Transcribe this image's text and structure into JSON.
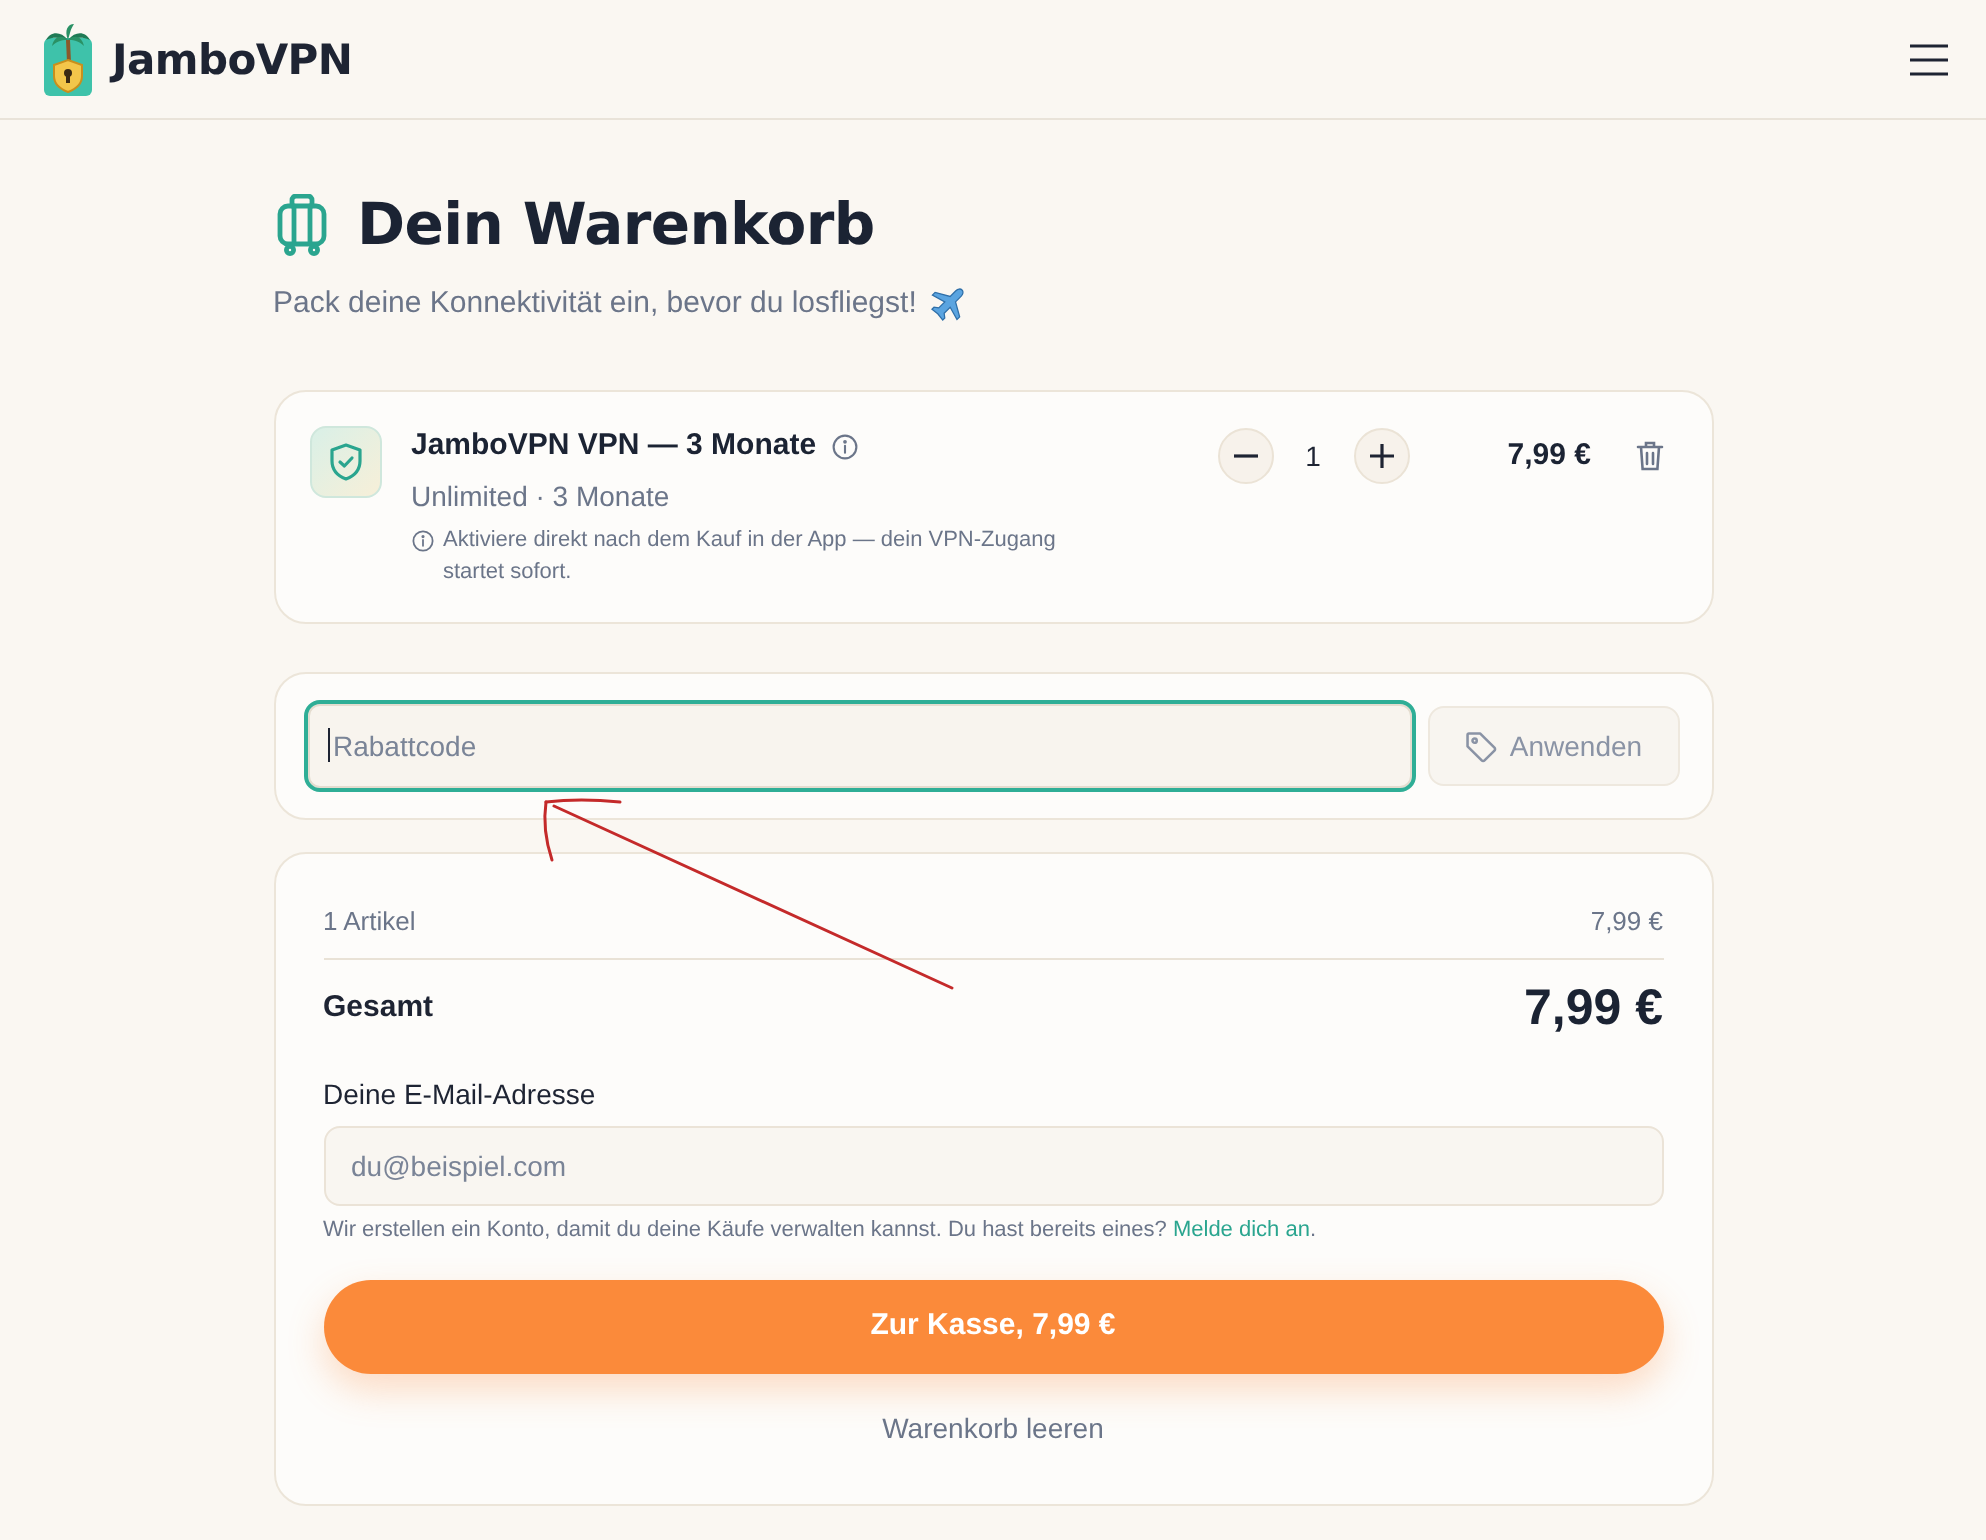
{
  "header": {
    "brand": "JamboVPN"
  },
  "page": {
    "title": "Dein Warenkorb",
    "subtitle": "Pack deine Konnektivität ein, bevor du losfliegst!"
  },
  "cart_items": [
    {
      "name": "JamboVPN VPN — 3 Monate",
      "details": "Unlimited · 3 Monate",
      "note": "Aktiviere direkt nach dem Kauf in der App — dein VPN-Zugang startet sofort.",
      "quantity": "1",
      "price": "7,99 €"
    }
  ],
  "coupon": {
    "placeholder": "Rabattcode",
    "focused": true,
    "apply_button": {
      "label": "Anwenden",
      "disabled": true
    }
  },
  "summary": {
    "items_label": "1 Artikel",
    "items_total": "7,99 €",
    "total_label": "Gesamt",
    "total": "7,99 €",
    "email": {
      "label": "Deine E-Mail-Adresse",
      "placeholder": "du@beispiel.com"
    },
    "hint": {
      "text": "Wir erstellen ein Konto, damit du deine Käufe verwalten kannst. Du hast bereits eines?",
      "link": "Melde dich an",
      "after": "."
    },
    "checkout_button": "Zur Kasse, 7,99 €",
    "clear_cart": "Warenkorb leeren"
  },
  "annotations": [
    {
      "kind": "arrow"
    }
  ]
}
